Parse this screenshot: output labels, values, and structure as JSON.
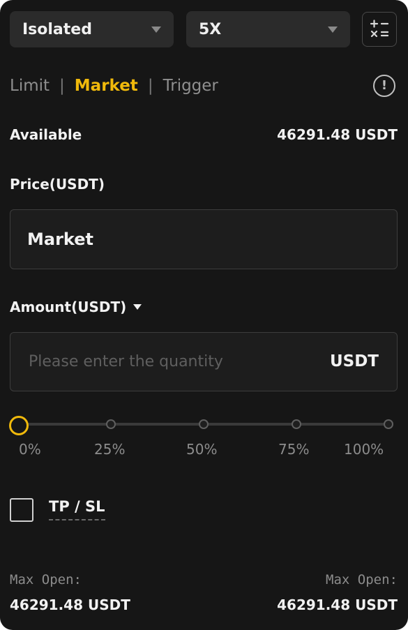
{
  "margin_mode": {
    "value": "Isolated"
  },
  "leverage": {
    "value": "5X"
  },
  "tabs": [
    {
      "label": "Limit"
    },
    {
      "label": "Market"
    },
    {
      "label": "Trigger"
    }
  ],
  "tab_separator": "|",
  "available": {
    "label": "Available",
    "value": "46291.48 USDT"
  },
  "price": {
    "label": "Price(USDT)",
    "value": "Market"
  },
  "amount": {
    "label": "Amount(USDT)",
    "placeholder": "Please enter the quantity",
    "unit": "USDT"
  },
  "slider": {
    "value_percent": 0,
    "marks": [
      "0%",
      "25%",
      "50%",
      "75%",
      "100%"
    ]
  },
  "tpsl": {
    "label": "TP / SL",
    "checked": false
  },
  "max_open_long": {
    "label": "Max Open:",
    "value": "46291.48 USDT"
  },
  "max_open_short": {
    "label": "Max Open:",
    "value": "46291.48 USDT"
  },
  "icons": {
    "calculator": "calculator-icon",
    "info": "info-icon"
  },
  "colors": {
    "accent": "#f0b90b",
    "background": "#161616"
  }
}
